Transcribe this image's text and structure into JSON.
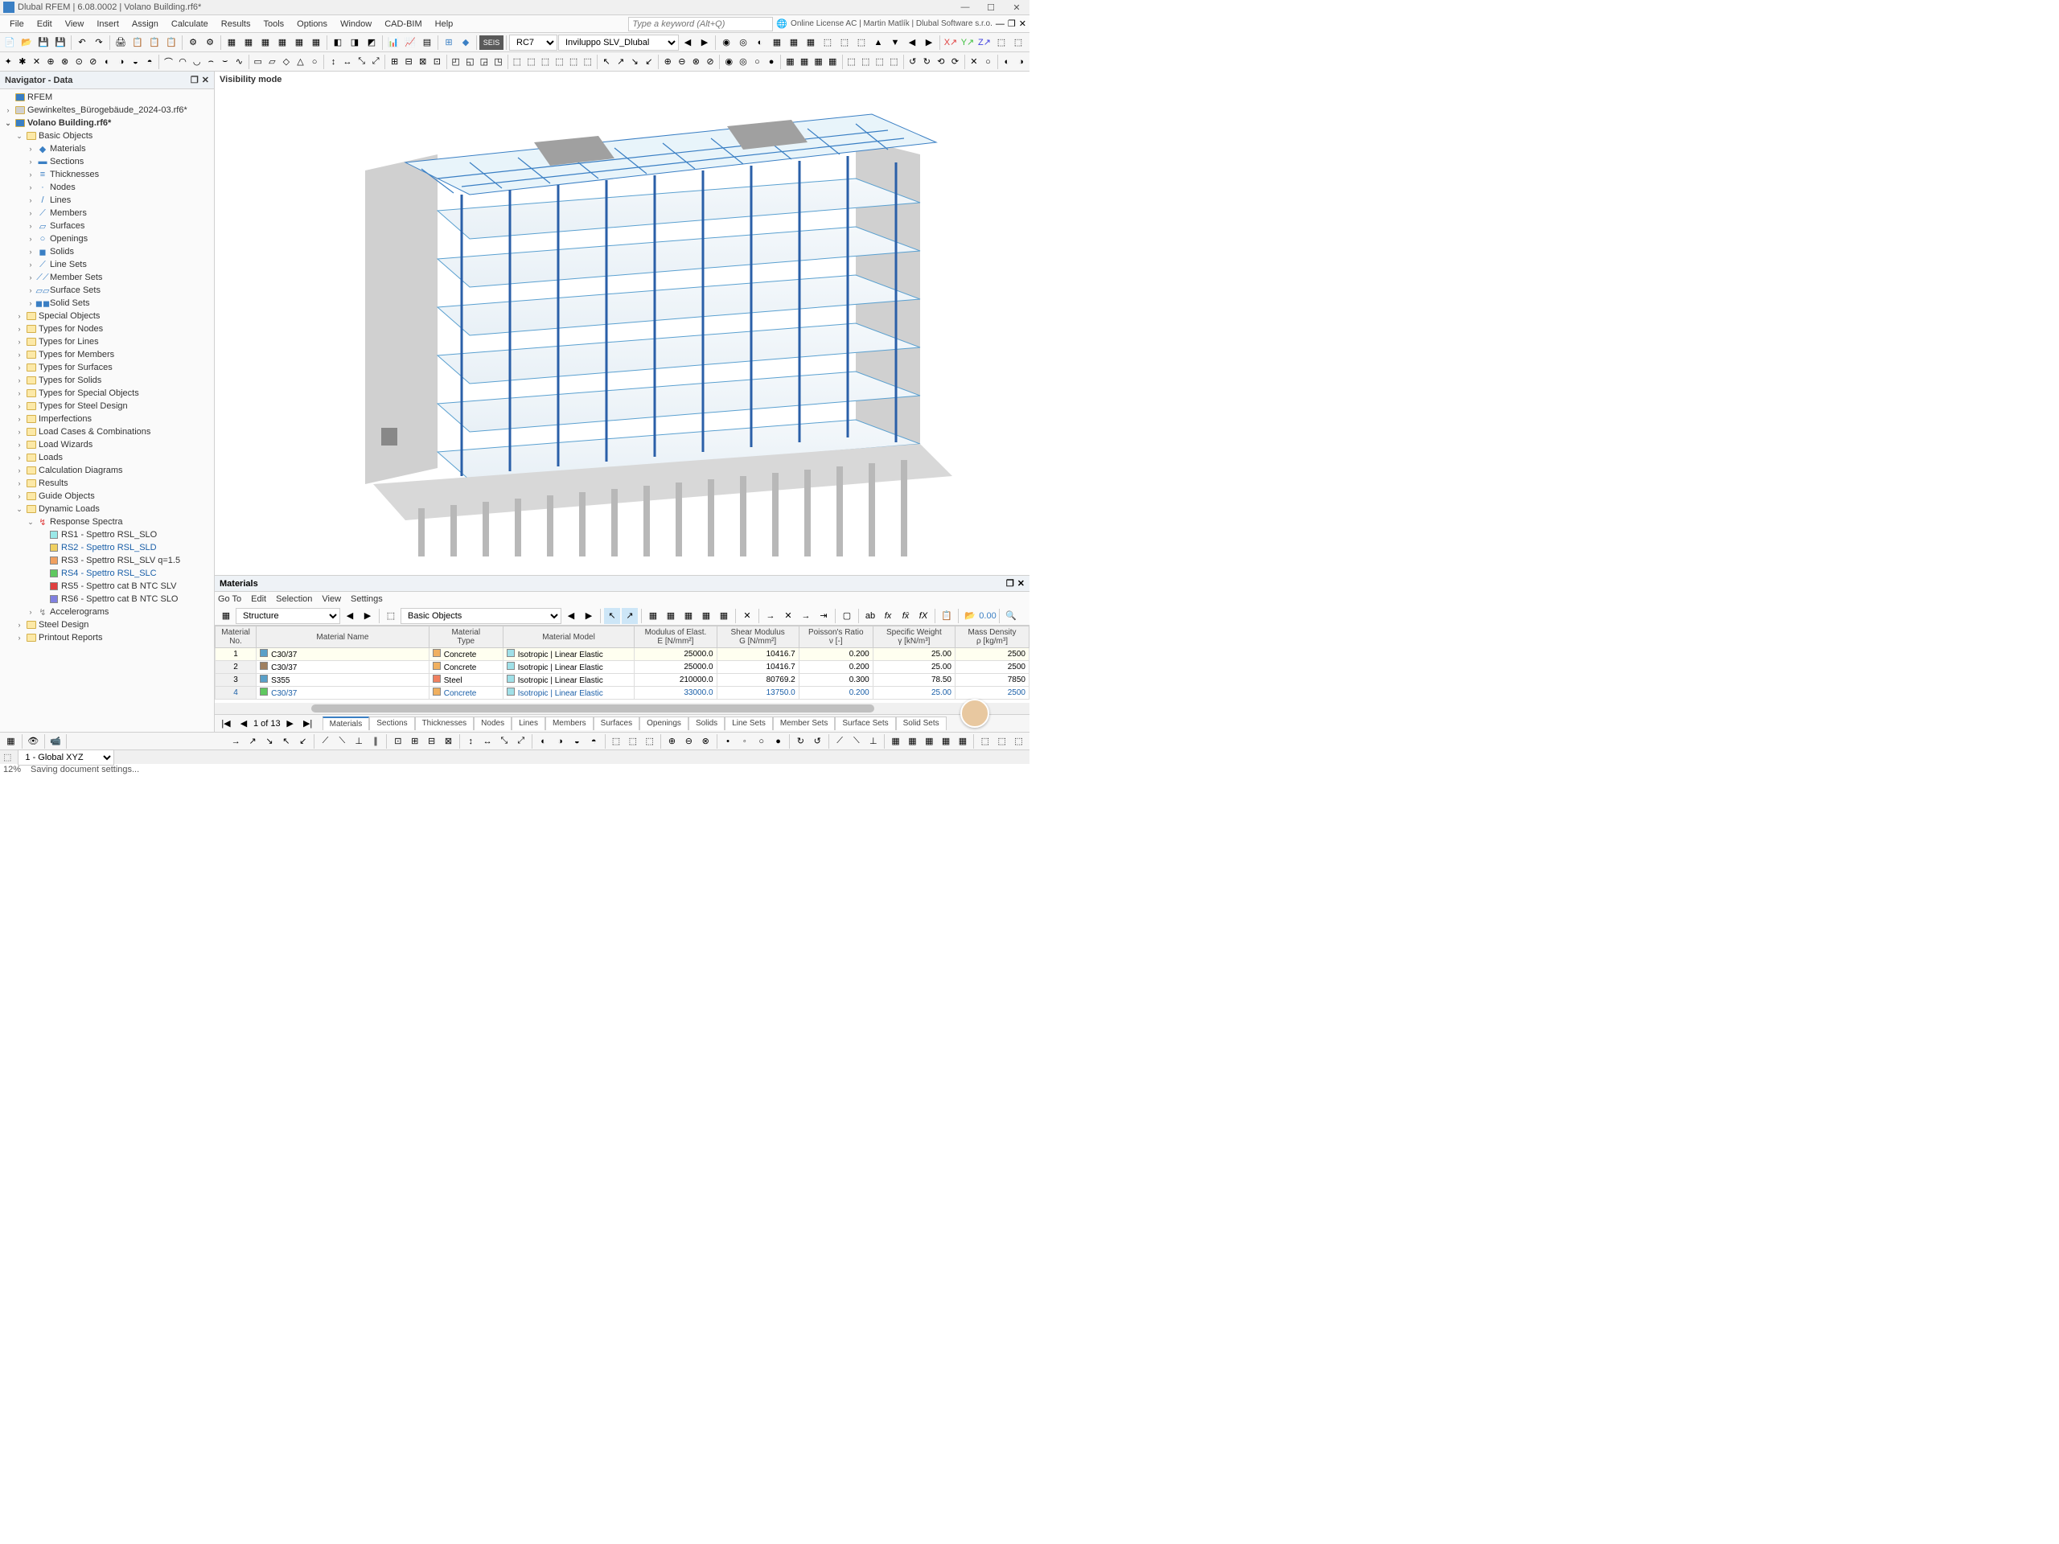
{
  "titlebar": {
    "text": "Dlubal RFEM | 6.08.0002 | Volano Building.rf6*"
  },
  "menubar": {
    "items": [
      "File",
      "Edit",
      "View",
      "Insert",
      "Assign",
      "Calculate",
      "Results",
      "Tools",
      "Options",
      "Window",
      "CAD-BIM",
      "Help"
    ],
    "keyword_placeholder": "Type a keyword (Alt+Q)",
    "license": "Online License AC | Martin Matlík | Dlubal Software s.r.o."
  },
  "toolbar1": {
    "seis": "SEIS",
    "rc_label": "RC7",
    "rc_value": "Inviluppo SLV_Dlubal"
  },
  "navigator": {
    "title": "Navigator - Data",
    "root": "RFEM",
    "file1": "Gewinkeltes_Bürogebäude_2024-03.rf6*",
    "file2": "Volano Building.rf6*",
    "basic_objects": "Basic Objects",
    "basic_items": [
      "Materials",
      "Sections",
      "Thicknesses",
      "Nodes",
      "Lines",
      "Members",
      "Surfaces",
      "Openings",
      "Solids",
      "Line Sets",
      "Member Sets",
      "Surface Sets",
      "Solid Sets"
    ],
    "cats": [
      "Special Objects",
      "Types for Nodes",
      "Types for Lines",
      "Types for Members",
      "Types for Surfaces",
      "Types for Solids",
      "Types for Special Objects",
      "Types for Steel Design",
      "Imperfections",
      "Load Cases & Combinations",
      "Load Wizards",
      "Loads",
      "Calculation Diagrams",
      "Results",
      "Guide Objects"
    ],
    "dynamic": "Dynamic Loads",
    "response_spectra": "Response Spectra",
    "rs": [
      {
        "label": "RS1 - Spettro RSL_SLO",
        "color": "#9ae8e8"
      },
      {
        "label": "RS2 - Spettro RSL_SLD",
        "color": "#f0d060",
        "link": true
      },
      {
        "label": "RS3 - Spettro RSL_SLV q=1.5",
        "color": "#f0a060"
      },
      {
        "label": "RS4 - Spettro RSL_SLC",
        "color": "#60c860",
        "link": true
      },
      {
        "label": "RS5 - Spettro cat B NTC SLV",
        "color": "#e04040"
      },
      {
        "label": "RS6 - Spettro cat B NTC SLO",
        "color": "#8080e0"
      }
    ],
    "accelerograms": "Accelerograms",
    "steel_design": "Steel Design",
    "printout": "Printout Reports"
  },
  "viewport": {
    "label": "Visibility mode"
  },
  "materials": {
    "title": "Materials",
    "menu": [
      "Go To",
      "Edit",
      "Selection",
      "View",
      "Settings"
    ],
    "combo1": "Structure",
    "combo2": "Basic Objects",
    "headers": [
      "Material\nNo.",
      "Material Name",
      "Material\nType",
      "Material Model",
      "Modulus of Elast.\nE [N/mm²]",
      "Shear Modulus\nG [N/mm²]",
      "Poisson's Ratio\nν [-]",
      "Specific Weight\nγ [kN/m³]",
      "Mass Density\nρ [kg/m³]"
    ],
    "rows": [
      {
        "no": "1",
        "name": "C30/37",
        "color": "#5aa0c8",
        "type": "Concrete",
        "tcolor": "#f0b060",
        "model": "Isotropic | Linear Elastic",
        "mcolor": "#a0e0e8",
        "e": "25000.0",
        "g": "10416.7",
        "v": "0.200",
        "w": "25.00",
        "d": "2500"
      },
      {
        "no": "2",
        "name": "C30/37",
        "color": "#a08060",
        "type": "Concrete",
        "tcolor": "#f0b060",
        "model": "Isotropic | Linear Elastic",
        "mcolor": "#a0e0e8",
        "e": "25000.0",
        "g": "10416.7",
        "v": "0.200",
        "w": "25.00",
        "d": "2500"
      },
      {
        "no": "3",
        "name": "S355",
        "color": "#5aa0c8",
        "type": "Steel",
        "tcolor": "#f08060",
        "model": "Isotropic | Linear Elastic",
        "mcolor": "#a0e0e8",
        "e": "210000.0",
        "g": "80769.2",
        "v": "0.300",
        "w": "78.50",
        "d": "7850"
      },
      {
        "no": "4",
        "name": "C30/37",
        "color": "#60c860",
        "type": "Concrete",
        "tcolor": "#f0b060",
        "model": "Isotropic | Linear Elastic",
        "mcolor": "#a0e0e8",
        "e": "33000.0",
        "g": "13750.0",
        "v": "0.200",
        "w": "25.00",
        "d": "2500",
        "link": true
      }
    ],
    "nav_text": "1 of 13",
    "tabs": [
      "Materials",
      "Sections",
      "Thicknesses",
      "Nodes",
      "Lines",
      "Members",
      "Surfaces",
      "Openings",
      "Solids",
      "Line Sets",
      "Member Sets",
      "Surface Sets",
      "Solid Sets"
    ]
  },
  "status": {
    "coord": "1 - Global XYZ",
    "pct": "12%",
    "msg": "Saving document settings..."
  }
}
